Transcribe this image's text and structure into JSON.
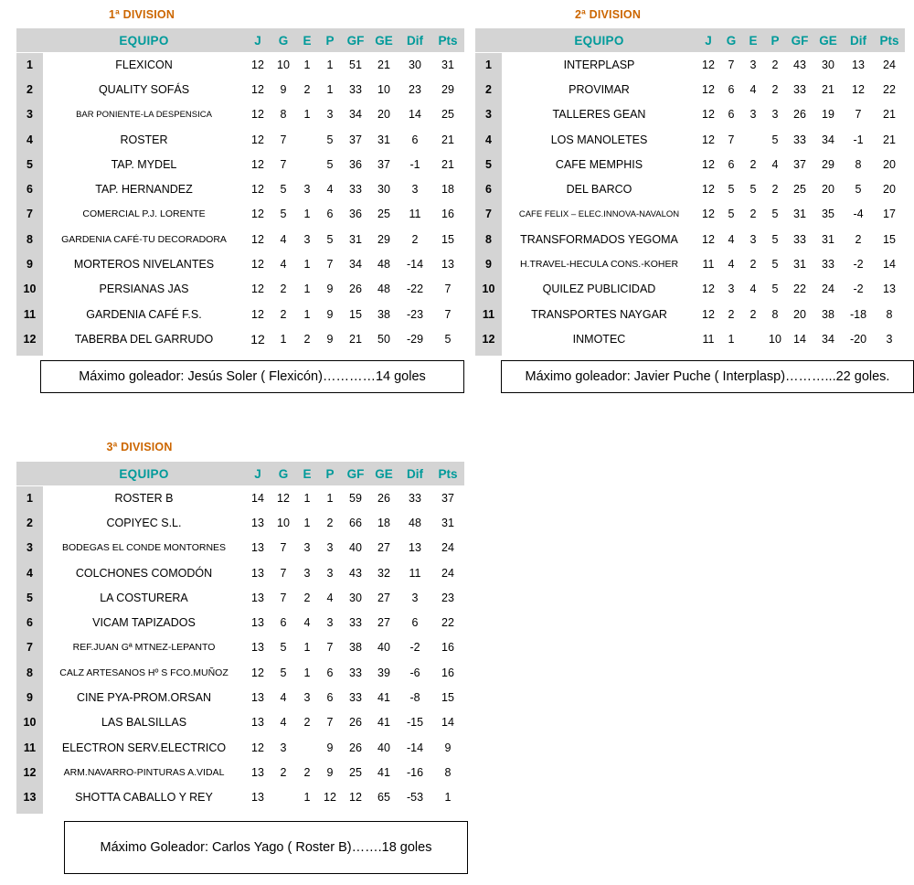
{
  "colors": {
    "accent_teal": "#009a9a",
    "title_orange": "#cc6600",
    "header_grey": "#d4d4d4",
    "text": "#000000"
  },
  "columns": {
    "rank": "",
    "team": "EQUIPO",
    "j": "J",
    "g": "G",
    "e": "E",
    "p": "P",
    "gf": "GF",
    "ge": "GE",
    "dif": "Dif",
    "pts": "Pts"
  },
  "leagues": [
    {
      "id": "division-1",
      "title": "1ª DIVISION",
      "rows": [
        {
          "rank": "1",
          "team": "FLEXICON",
          "j": "12",
          "g": "10",
          "e": "1",
          "p": "1",
          "gf": "51",
          "ge": "21",
          "dif": "30",
          "pts": "31"
        },
        {
          "rank": "2",
          "team": "QUALITY SOFÁS",
          "j": "12",
          "g": "9",
          "e": "2",
          "p": "1",
          "gf": "33",
          "ge": "10",
          "dif": "23",
          "pts": "29"
        },
        {
          "rank": "3",
          "team": "BAR PONIENTE-LA DESPENSICA",
          "j": "12",
          "g": "8",
          "e": "1",
          "p": "3",
          "gf": "34",
          "ge": "20",
          "dif": "14",
          "pts": "25"
        },
        {
          "rank": "4",
          "team": "ROSTER",
          "j": "12",
          "g": "7",
          "e": "",
          "p": "5",
          "gf": "37",
          "ge": "31",
          "dif": "6",
          "pts": "21"
        },
        {
          "rank": "5",
          "team": "TAP. MYDEL",
          "j": "12",
          "g": "7",
          "e": "",
          "p": "5",
          "gf": "36",
          "ge": "37",
          "dif": "-1",
          "pts": "21"
        },
        {
          "rank": "6",
          "team": "TAP. HERNANDEZ",
          "j": "12",
          "g": "5",
          "e": "3",
          "p": "4",
          "gf": "33",
          "ge": "30",
          "dif": "3",
          "pts": "18"
        },
        {
          "rank": "7",
          "team": "COMERCIAL P.J. LORENTE",
          "j": "12",
          "g": "5",
          "e": "1",
          "p": "6",
          "gf": "36",
          "ge": "25",
          "dif": "11",
          "pts": "16"
        },
        {
          "rank": "8",
          "team": "GARDENIA CAFÉ-TU DECORADORA",
          "j": "12",
          "g": "4",
          "e": "3",
          "p": "5",
          "gf": "31",
          "ge": "29",
          "dif": "2",
          "pts": "15"
        },
        {
          "rank": "9",
          "team": "MORTEROS NIVELANTES",
          "j": "12",
          "g": "4",
          "e": "1",
          "p": "7",
          "gf": "34",
          "ge": "48",
          "dif": "-14",
          "pts": "13"
        },
        {
          "rank": "10",
          "team": "PERSIANAS JAS",
          "j": "12",
          "g": "2",
          "e": "1",
          "p": "9",
          "gf": "26",
          "ge": "48",
          "dif": "-22",
          "pts": "7"
        },
        {
          "rank": "11",
          "team": "GARDENIA CAFÉ F.S.",
          "j": "12",
          "g": "2",
          "e": "1",
          "p": "9",
          "gf": "15",
          "ge": "38",
          "dif": "-23",
          "pts": "7"
        },
        {
          "rank": "12",
          "team": "TABERBA DEL GARRUDO",
          "j": "12",
          "g": "1",
          "e": "2",
          "p": "9",
          "gf": "21",
          "ge": "50",
          "dif": "-29",
          "pts": "5"
        }
      ],
      "scorer": "Máximo goleador: Jesús Soler ( Flexicón)…………14 goles"
    },
    {
      "id": "division-2",
      "title": "2ª DIVISION",
      "rows": [
        {
          "rank": "1",
          "team": "INTERPLASP",
          "j": "12",
          "g": "7",
          "e": "3",
          "p": "2",
          "gf": "43",
          "ge": "30",
          "dif": "13",
          "pts": "24"
        },
        {
          "rank": "2",
          "team": "PROVIMAR",
          "j": "12",
          "g": "6",
          "e": "4",
          "p": "2",
          "gf": "33",
          "ge": "21",
          "dif": "12",
          "pts": "22"
        },
        {
          "rank": "3",
          "team": "TALLERES GEAN",
          "j": "12",
          "g": "6",
          "e": "3",
          "p": "3",
          "gf": "26",
          "ge": "19",
          "dif": "7",
          "pts": "21"
        },
        {
          "rank": "4",
          "team": "LOS MANOLETES",
          "j": "12",
          "g": "7",
          "e": "",
          "p": "5",
          "gf": "33",
          "ge": "34",
          "dif": "-1",
          "pts": "21"
        },
        {
          "rank": "5",
          "team": "CAFE MEMPHIS",
          "j": "12",
          "g": "6",
          "e": "2",
          "p": "4",
          "gf": "37",
          "ge": "29",
          "dif": "8",
          "pts": "20"
        },
        {
          "rank": "6",
          "team": "DEL BARCO",
          "j": "12",
          "g": "5",
          "e": "5",
          "p": "2",
          "gf": "25",
          "ge": "20",
          "dif": "5",
          "pts": "20"
        },
        {
          "rank": "7",
          "team": "CAFE FELIX – ELEC.INNOVA-NAVALON",
          "j": "12",
          "g": "5",
          "e": "2",
          "p": "5",
          "gf": "31",
          "ge": "35",
          "dif": "-4",
          "pts": "17"
        },
        {
          "rank": "8",
          "team": "TRANSFORMADOS YEGOMA",
          "j": "12",
          "g": "4",
          "e": "3",
          "p": "5",
          "gf": "33",
          "ge": "31",
          "dif": "2",
          "pts": "15"
        },
        {
          "rank": "9",
          "team": "H.TRAVEL-HECULA CONS.-KOHER",
          "j": "11",
          "g": "4",
          "e": "2",
          "p": "5",
          "gf": "31",
          "ge": "33",
          "dif": "-2",
          "pts": "14"
        },
        {
          "rank": "10",
          "team": "QUILEZ PUBLICIDAD",
          "j": "12",
          "g": "3",
          "e": "4",
          "p": "5",
          "gf": "22",
          "ge": "24",
          "dif": "-2",
          "pts": "13"
        },
        {
          "rank": "11",
          "team": "TRANSPORTES NAYGAR",
          "j": "12",
          "g": "2",
          "e": "2",
          "p": "8",
          "gf": "20",
          "ge": "38",
          "dif": "-18",
          "pts": "8"
        },
        {
          "rank": "12",
          "team": "INMOTEC",
          "j": "11",
          "g": "1",
          "e": "",
          "p": "10",
          "gf": "14",
          "ge": "34",
          "dif": "-20",
          "pts": "3"
        }
      ],
      "scorer": "Máximo goleador: Javier Puche ( Interplasp)………...22 goles."
    },
    {
      "id": "division-3",
      "title": "3ª DIVISION",
      "rows": [
        {
          "rank": "1",
          "team": "ROSTER B",
          "j": "14",
          "g": "12",
          "e": "1",
          "p": "1",
          "gf": "59",
          "ge": "26",
          "dif": "33",
          "pts": "37"
        },
        {
          "rank": "2",
          "team": "COPIYEC S.L.",
          "j": "13",
          "g": "10",
          "e": "1",
          "p": "2",
          "gf": "66",
          "ge": "18",
          "dif": "48",
          "pts": "31"
        },
        {
          "rank": "3",
          "team": "BODEGAS EL CONDE MONTORNES",
          "j": "13",
          "g": "7",
          "e": "3",
          "p": "3",
          "gf": "40",
          "ge": "27",
          "dif": "13",
          "pts": "24"
        },
        {
          "rank": "4",
          "team": "COLCHONES COMODÓN",
          "j": "13",
          "g": "7",
          "e": "3",
          "p": "3",
          "gf": "43",
          "ge": "32",
          "dif": "11",
          "pts": "24"
        },
        {
          "rank": "5",
          "team": "LA COSTURERA",
          "j": "13",
          "g": "7",
          "e": "2",
          "p": "4",
          "gf": "30",
          "ge": "27",
          "dif": "3",
          "pts": "23"
        },
        {
          "rank": "6",
          "team": "VICAM TAPIZADOS",
          "j": "13",
          "g": "6",
          "e": "4",
          "p": "3",
          "gf": "33",
          "ge": "27",
          "dif": "6",
          "pts": "22"
        },
        {
          "rank": "7",
          "team": "REF.JUAN Gª MTNEZ-LEPANTO",
          "j": "13",
          "g": "5",
          "e": "1",
          "p": "7",
          "gf": "38",
          "ge": "40",
          "dif": "-2",
          "pts": "16"
        },
        {
          "rank": "8",
          "team": "CALZ ARTESANOS  Hº S FCO.MUÑOZ",
          "j": "12",
          "g": "5",
          "e": "1",
          "p": "6",
          "gf": "33",
          "ge": "39",
          "dif": "-6",
          "pts": "16"
        },
        {
          "rank": "9",
          "team": "CINE PYA-PROM.ORSAN",
          "j": "13",
          "g": "4",
          "e": "3",
          "p": "6",
          "gf": "33",
          "ge": "41",
          "dif": "-8",
          "pts": "15"
        },
        {
          "rank": "10",
          "team": "LAS BALSILLAS",
          "j": "13",
          "g": "4",
          "e": "2",
          "p": "7",
          "gf": "26",
          "ge": "41",
          "dif": "-15",
          "pts": "14"
        },
        {
          "rank": "11",
          "team": "ELECTRON SERV.ELECTRICO",
          "j": "12",
          "g": "3",
          "e": "",
          "p": "9",
          "gf": "26",
          "ge": "40",
          "dif": "-14",
          "pts": "9"
        },
        {
          "rank": "12",
          "team": "ARM.NAVARRO-PINTURAS A.VIDAL",
          "j": "13",
          "g": "2",
          "e": "2",
          "p": "9",
          "gf": "25",
          "ge": "41",
          "dif": "-16",
          "pts": "8"
        },
        {
          "rank": "13",
          "team": "SHOTTA CABALLO Y REY",
          "j": "13",
          "g": "",
          "e": "1",
          "p": "12",
          "gf": "12",
          "ge": "65",
          "dif": "-53",
          "pts": "1"
        }
      ],
      "scorer": "Máximo Goleador: Carlos Yago ( Roster B)…….18 goles"
    }
  ]
}
